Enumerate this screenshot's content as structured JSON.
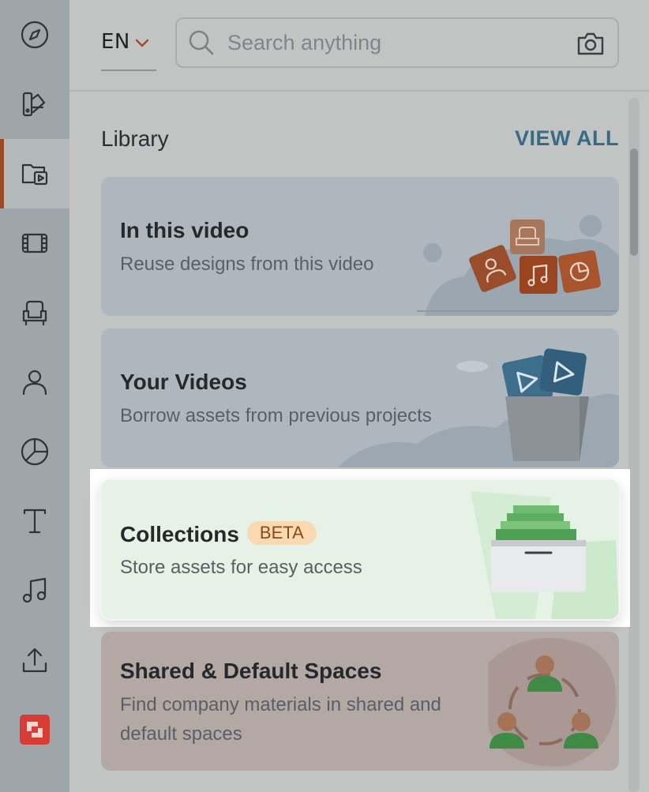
{
  "colors": {
    "accent_active": "#9a4a24",
    "view_all": "#386c85",
    "badge_bg": "#f8d9b2",
    "brand_logo": "#d83b34"
  },
  "sidebar": {
    "items": [
      {
        "icon": "compass-icon"
      },
      {
        "icon": "swatches-icon"
      },
      {
        "icon": "library-folder-icon",
        "active": true
      },
      {
        "icon": "film-icon"
      },
      {
        "icon": "armchair-icon"
      },
      {
        "icon": "person-icon"
      },
      {
        "icon": "pie-chart-icon"
      },
      {
        "icon": "text-icon"
      },
      {
        "icon": "music-note-icon"
      },
      {
        "icon": "upload-icon"
      },
      {
        "icon": "brand-logo-icon"
      }
    ]
  },
  "topbar": {
    "language": "EN",
    "search_placeholder": "Search anything",
    "search_icon": "search-icon",
    "camera_icon": "camera-icon"
  },
  "library": {
    "title": "Library",
    "view_all": "VIEW ALL",
    "cards": [
      {
        "title": "In this video",
        "description": "Reuse designs from this video"
      },
      {
        "title": "Your Videos",
        "description": "Borrow assets from previous projects"
      },
      {
        "title": "Collections",
        "badge": "BETA",
        "description": "Store assets for easy access"
      },
      {
        "title": "Shared & Default Spaces",
        "description": "Find company materials in shared and default spaces"
      }
    ]
  }
}
